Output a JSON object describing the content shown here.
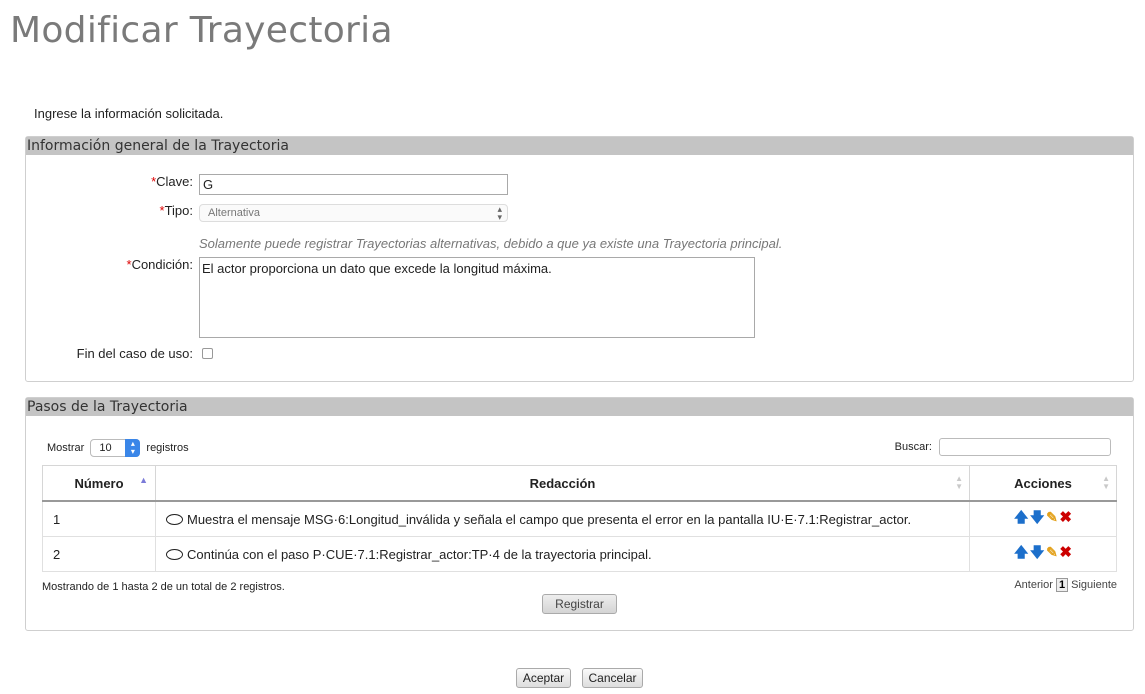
{
  "page": {
    "title": "Modificar Trayectoria",
    "instructions": "Ingrese la información solicitada."
  },
  "general": {
    "header": "Información general de la Trayectoria",
    "required_mark": "*",
    "clave_label": "Clave:",
    "clave_value": "G",
    "tipo_label": "Tipo:",
    "tipo_value": "Alternativa",
    "tipo_hint": "Solamente puede registrar Trayectorias alternativas, debido a que ya existe una Trayectoria principal.",
    "condicion_label": "Condición:",
    "condicion_value": "El actor proporciona un dato que excede la longitud máxima.",
    "fin_label": "Fin del caso de uso:",
    "fin_checked": false
  },
  "steps": {
    "header": "Pasos de la Trayectoria",
    "show_label": "Mostrar",
    "page_size": "10",
    "records_label": "registros",
    "search_label": "Buscar:",
    "columns": [
      "Número",
      "Redacción",
      "Acciones"
    ],
    "rows": [
      {
        "numero": "1",
        "redaccion": "Muestra el mensaje MSG·6:Longitud_inválida y señala el campo que presenta el error en la pantalla IU·E·7.1:Registrar_actor."
      },
      {
        "numero": "2",
        "redaccion": "Continúa con el paso P·CUE·7.1:Registrar_actor:TP·4 de la trayectoria principal."
      }
    ],
    "info": "Mostrando de 1 hasta 2 de un total de 2 registros.",
    "prev_label": "Anterior",
    "current_page": "1",
    "next_label": "Siguiente",
    "register_button": "Registrar"
  },
  "footer": {
    "accept_button": "Aceptar",
    "cancel_button": "Cancelar"
  },
  "icons": {
    "move_up": "arrow-up-icon",
    "move_down": "arrow-down-icon",
    "edit": "pencil-icon",
    "delete": "delete-x-icon"
  },
  "colors": {
    "panel_header": "#c4c4c4",
    "required": "#dd0000",
    "action_arrow": "#1c6fcb",
    "action_delete": "#cc0000"
  }
}
